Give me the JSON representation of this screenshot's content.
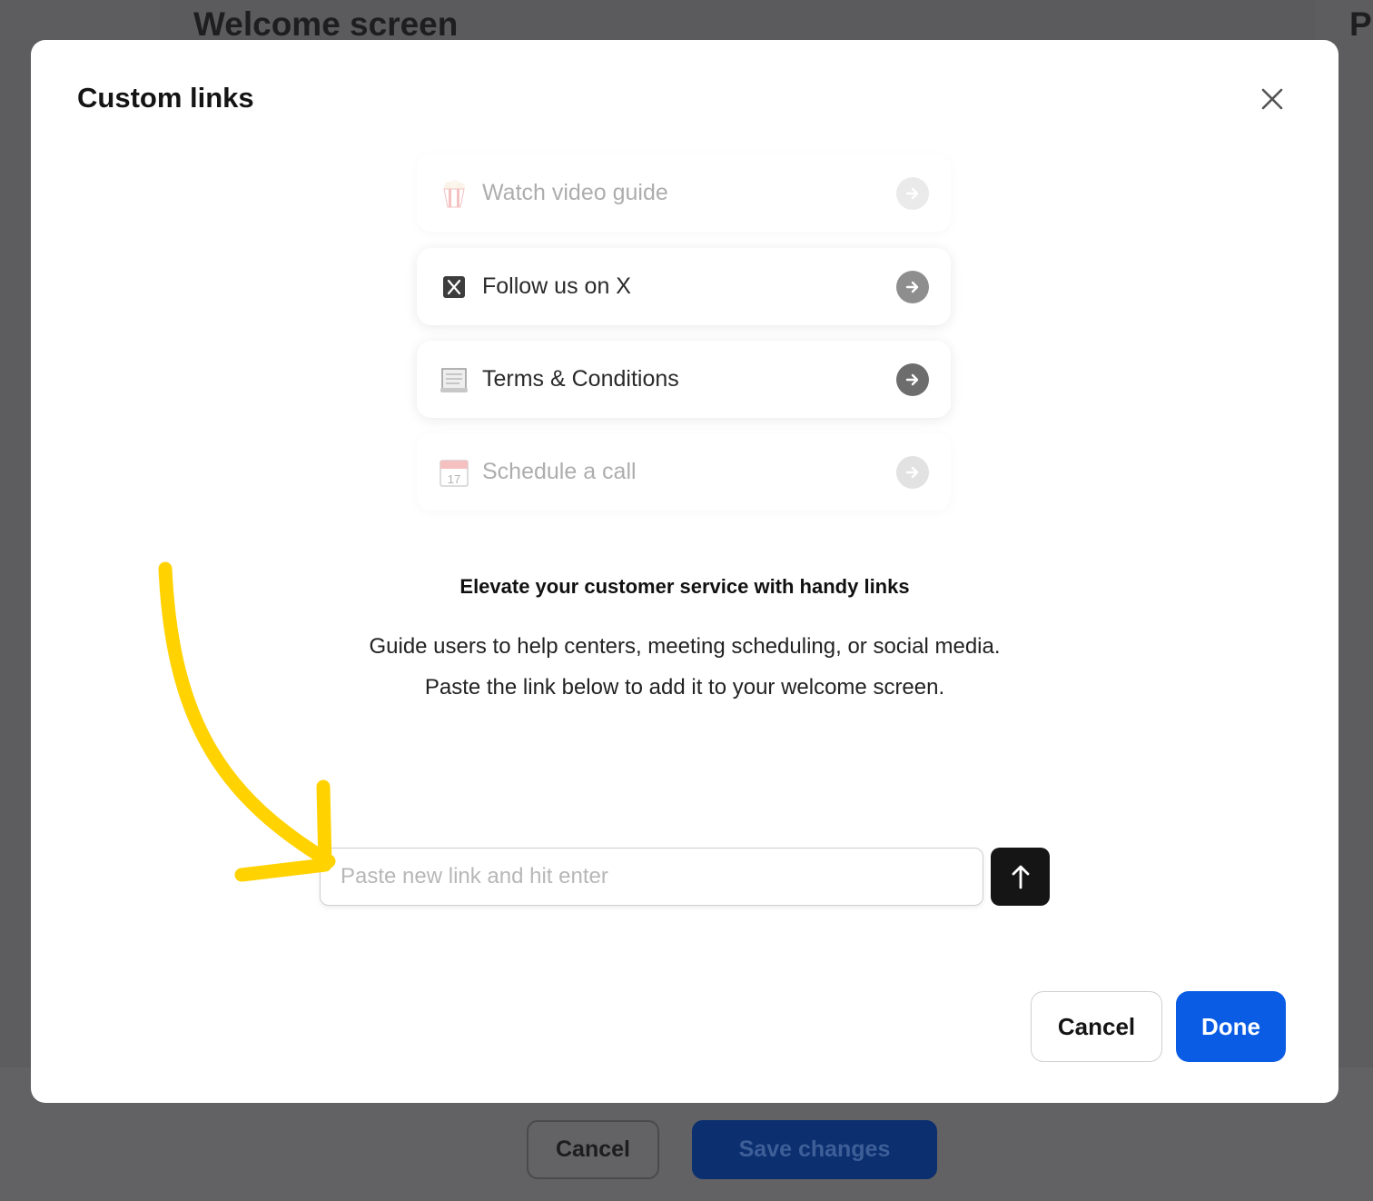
{
  "background": {
    "title": "Welcome screen",
    "right_title_fragment": "P",
    "footer": {
      "cancel_label": "Cancel",
      "save_label": "Save changes"
    }
  },
  "modal": {
    "title": "Custom links",
    "links": [
      {
        "label": "Watch video guide",
        "icon": "popcorn-icon",
        "faded": true
      },
      {
        "label": "Follow us on X",
        "icon": "x-logo-icon",
        "faded": false
      },
      {
        "label": "Terms & Conditions",
        "icon": "scroll-icon",
        "faded": false
      },
      {
        "label": "Schedule a call",
        "icon": "calendar-icon",
        "faded": true
      }
    ],
    "calendar_day": "17",
    "heading": "Elevate your customer service with handy links",
    "description_line1": "Guide users to help centers, meeting scheduling, or social media.",
    "description_line2": "Paste the link below to add it to your welcome screen.",
    "input": {
      "placeholder": "Paste new link and hit enter",
      "value": ""
    },
    "cancel_label": "Cancel",
    "done_label": "Done"
  },
  "colors": {
    "primary": "#0b5ce5",
    "submit_button": "#151515",
    "annotation_arrow": "#ffd200",
    "overlay": "#5d5d5f"
  }
}
